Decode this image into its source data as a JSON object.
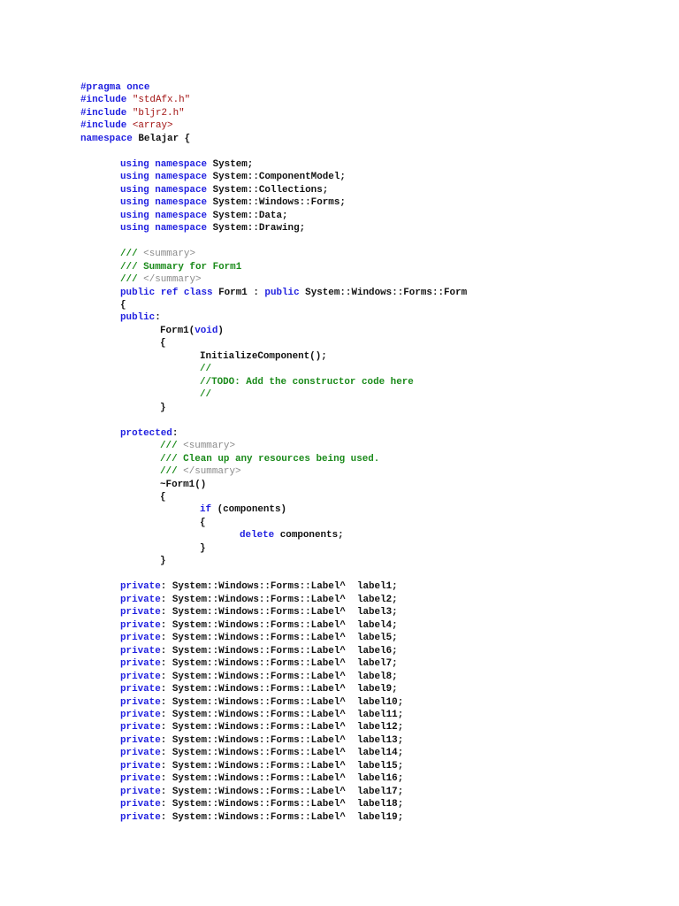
{
  "colors": {
    "keyword": "#1f1fe0",
    "string": "#a31515",
    "comment": "#1a8a1a",
    "doc_tag": "#8a8a8a",
    "text": "#111111"
  },
  "lines": [
    {
      "indent": 0,
      "segs": [
        [
          "kw",
          "#pragma once"
        ]
      ]
    },
    {
      "indent": 0,
      "segs": [
        [
          "kw",
          "#include "
        ],
        [
          "str",
          "\"stdAfx.h\""
        ]
      ]
    },
    {
      "indent": 0,
      "segs": [
        [
          "kw",
          "#include "
        ],
        [
          "str",
          "\"bljr2.h\""
        ]
      ]
    },
    {
      "indent": 0,
      "segs": [
        [
          "kw",
          "#include "
        ],
        [
          "str",
          "<array>"
        ]
      ]
    },
    {
      "indent": 0,
      "segs": [
        [
          "kw",
          "namespace"
        ],
        [
          "tx",
          " Belajar {"
        ]
      ]
    },
    {
      "indent": 0,
      "segs": []
    },
    {
      "indent": 1,
      "segs": [
        [
          "kw",
          "using namespace"
        ],
        [
          "tx",
          " System;"
        ]
      ]
    },
    {
      "indent": 1,
      "segs": [
        [
          "kw",
          "using namespace"
        ],
        [
          "tx",
          " System::ComponentModel;"
        ]
      ]
    },
    {
      "indent": 1,
      "segs": [
        [
          "kw",
          "using namespace"
        ],
        [
          "tx",
          " System::Collections;"
        ]
      ]
    },
    {
      "indent": 1,
      "segs": [
        [
          "kw",
          "using namespace"
        ],
        [
          "tx",
          " System::Windows::Forms;"
        ]
      ]
    },
    {
      "indent": 1,
      "segs": [
        [
          "kw",
          "using namespace"
        ],
        [
          "tx",
          " System::Data;"
        ]
      ]
    },
    {
      "indent": 1,
      "segs": [
        [
          "kw",
          "using namespace"
        ],
        [
          "tx",
          " System::Drawing;"
        ]
      ]
    },
    {
      "indent": 0,
      "segs": []
    },
    {
      "indent": 1,
      "segs": [
        [
          "cm",
          "/// "
        ],
        [
          "doc",
          "<summary>"
        ]
      ]
    },
    {
      "indent": 1,
      "segs": [
        [
          "cm",
          "/// Summary for Form1"
        ]
      ]
    },
    {
      "indent": 1,
      "segs": [
        [
          "cm",
          "/// "
        ],
        [
          "doc",
          "</summary>"
        ]
      ]
    },
    {
      "indent": 1,
      "segs": [
        [
          "kw",
          "public ref class"
        ],
        [
          "tx",
          " Form1 : "
        ],
        [
          "kw",
          "public"
        ],
        [
          "tx",
          " System::Windows::Forms::Form"
        ]
      ]
    },
    {
      "indent": 1,
      "segs": [
        [
          "tx",
          "{"
        ]
      ]
    },
    {
      "indent": 1,
      "segs": [
        [
          "kw",
          "public"
        ],
        [
          "tx",
          ":"
        ]
      ]
    },
    {
      "indent": 2,
      "segs": [
        [
          "tx",
          "Form1("
        ],
        [
          "kw",
          "void"
        ],
        [
          "tx",
          ")"
        ]
      ]
    },
    {
      "indent": 2,
      "segs": [
        [
          "tx",
          "{"
        ]
      ]
    },
    {
      "indent": 3,
      "segs": [
        [
          "tx",
          "InitializeComponent();"
        ]
      ]
    },
    {
      "indent": 3,
      "segs": [
        [
          "cm",
          "//"
        ]
      ]
    },
    {
      "indent": 3,
      "segs": [
        [
          "cm",
          "//TODO: Add the constructor code here"
        ]
      ]
    },
    {
      "indent": 3,
      "segs": [
        [
          "cm",
          "//"
        ]
      ]
    },
    {
      "indent": 2,
      "segs": [
        [
          "tx",
          "}"
        ]
      ]
    },
    {
      "indent": 0,
      "segs": []
    },
    {
      "indent": 1,
      "segs": [
        [
          "kw",
          "protected"
        ],
        [
          "tx",
          ":"
        ]
      ]
    },
    {
      "indent": 2,
      "segs": [
        [
          "cm",
          "/// "
        ],
        [
          "doc",
          "<summary>"
        ]
      ]
    },
    {
      "indent": 2,
      "segs": [
        [
          "cm",
          "/// Clean up any resources being used."
        ]
      ]
    },
    {
      "indent": 2,
      "segs": [
        [
          "cm",
          "/// "
        ],
        [
          "doc",
          "</summary>"
        ]
      ]
    },
    {
      "indent": 2,
      "segs": [
        [
          "tx",
          "~Form1()"
        ]
      ]
    },
    {
      "indent": 2,
      "segs": [
        [
          "tx",
          "{"
        ]
      ]
    },
    {
      "indent": 3,
      "segs": [
        [
          "kw",
          "if"
        ],
        [
          "tx",
          " (components)"
        ]
      ]
    },
    {
      "indent": 3,
      "segs": [
        [
          "tx",
          "{"
        ]
      ]
    },
    {
      "indent": 4,
      "segs": [
        [
          "kw",
          "delete"
        ],
        [
          "tx",
          " components;"
        ]
      ]
    },
    {
      "indent": 3,
      "segs": [
        [
          "tx",
          "}"
        ]
      ]
    },
    {
      "indent": 2,
      "segs": [
        [
          "tx",
          "}"
        ]
      ]
    },
    {
      "indent": 0,
      "segs": []
    },
    {
      "indent": 1,
      "segs": [
        [
          "kw",
          "private"
        ],
        [
          "tx",
          ": System::Windows::Forms::Label^  label1;"
        ]
      ]
    },
    {
      "indent": 1,
      "segs": [
        [
          "kw",
          "private"
        ],
        [
          "tx",
          ": System::Windows::Forms::Label^  label2;"
        ]
      ]
    },
    {
      "indent": 1,
      "segs": [
        [
          "kw",
          "private"
        ],
        [
          "tx",
          ": System::Windows::Forms::Label^  label3;"
        ]
      ]
    },
    {
      "indent": 1,
      "segs": [
        [
          "kw",
          "private"
        ],
        [
          "tx",
          ": System::Windows::Forms::Label^  label4;"
        ]
      ]
    },
    {
      "indent": 1,
      "segs": [
        [
          "kw",
          "private"
        ],
        [
          "tx",
          ": System::Windows::Forms::Label^  label5;"
        ]
      ]
    },
    {
      "indent": 1,
      "segs": [
        [
          "kw",
          "private"
        ],
        [
          "tx",
          ": System::Windows::Forms::Label^  label6;"
        ]
      ]
    },
    {
      "indent": 1,
      "segs": [
        [
          "kw",
          "private"
        ],
        [
          "tx",
          ": System::Windows::Forms::Label^  label7;"
        ]
      ]
    },
    {
      "indent": 1,
      "segs": [
        [
          "kw",
          "private"
        ],
        [
          "tx",
          ": System::Windows::Forms::Label^  label8;"
        ]
      ]
    },
    {
      "indent": 1,
      "segs": [
        [
          "kw",
          "private"
        ],
        [
          "tx",
          ": System::Windows::Forms::Label^  label9;"
        ]
      ]
    },
    {
      "indent": 1,
      "segs": [
        [
          "kw",
          "private"
        ],
        [
          "tx",
          ": System::Windows::Forms::Label^  label10;"
        ]
      ]
    },
    {
      "indent": 1,
      "segs": [
        [
          "kw",
          "private"
        ],
        [
          "tx",
          ": System::Windows::Forms::Label^  label11;"
        ]
      ]
    },
    {
      "indent": 1,
      "segs": [
        [
          "kw",
          "private"
        ],
        [
          "tx",
          ": System::Windows::Forms::Label^  label12;"
        ]
      ]
    },
    {
      "indent": 1,
      "segs": [
        [
          "kw",
          "private"
        ],
        [
          "tx",
          ": System::Windows::Forms::Label^  label13;"
        ]
      ]
    },
    {
      "indent": 1,
      "segs": [
        [
          "kw",
          "private"
        ],
        [
          "tx",
          ": System::Windows::Forms::Label^  label14;"
        ]
      ]
    },
    {
      "indent": 1,
      "segs": [
        [
          "kw",
          "private"
        ],
        [
          "tx",
          ": System::Windows::Forms::Label^  label15;"
        ]
      ]
    },
    {
      "indent": 1,
      "segs": [
        [
          "kw",
          "private"
        ],
        [
          "tx",
          ": System::Windows::Forms::Label^  label16;"
        ]
      ]
    },
    {
      "indent": 1,
      "segs": [
        [
          "kw",
          "private"
        ],
        [
          "tx",
          ": System::Windows::Forms::Label^  label17;"
        ]
      ]
    },
    {
      "indent": 1,
      "segs": [
        [
          "kw",
          "private"
        ],
        [
          "tx",
          ": System::Windows::Forms::Label^  label18;"
        ]
      ]
    },
    {
      "indent": 1,
      "segs": [
        [
          "kw",
          "private"
        ],
        [
          "tx",
          ": System::Windows::Forms::Label^  label19;"
        ]
      ]
    }
  ]
}
